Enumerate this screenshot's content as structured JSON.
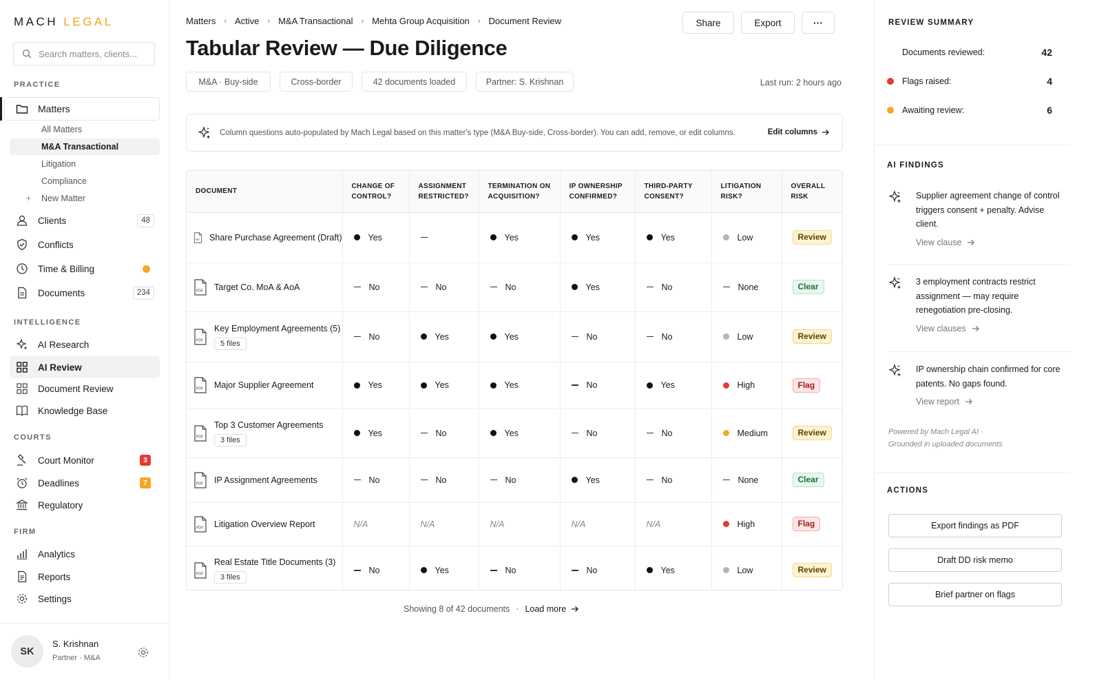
{
  "brand": {
    "part1": "MACH",
    "part2": "LEGAL",
    "accent": "#f2a11a"
  },
  "search": {
    "placeholder": "Search matters, clients..."
  },
  "sidebar": {
    "practice_label": "PRACTICE",
    "matters_label": "Matters",
    "matters_sub": [
      "All Matters",
      "M&A Transactional",
      "Litigation",
      "Compliance",
      "New Matter"
    ],
    "clients": {
      "label": "Clients",
      "count": "48"
    },
    "conflicts": {
      "label": "Conflicts"
    },
    "billing": {
      "label": "Time & Billing"
    },
    "documents": {
      "label": "Documents",
      "count": "234"
    },
    "intelligence_label": "INTELLIGENCE",
    "ai_research": "AI Research",
    "ai_review": "AI Review",
    "document_review": "Document Review",
    "knowledge_base": "Knowledge Base",
    "courts_label": "COURTS",
    "court_monitor": {
      "label": "Court Monitor",
      "count": "3"
    },
    "deadlines": {
      "label": "Deadlines",
      "count": "7"
    },
    "regulatory": "Regulatory",
    "firm_label": "FIRM",
    "analytics": "Analytics",
    "reports": "Reports",
    "settings": "Settings"
  },
  "user": {
    "initials": "SK",
    "name": "S. Krishnan",
    "role": "Partner · M&A"
  },
  "breadcrumb": [
    "Matters",
    "Active",
    "M&A Transactional",
    "Mehta Group Acquisition",
    "Document Review"
  ],
  "header": {
    "share": "Share",
    "export": "Export",
    "more": "···"
  },
  "title": "Tabular Review — Due Diligence",
  "tags": [
    "M&A · Buy-side",
    "Cross-border",
    "42 documents loaded",
    "Partner: S. Krishnan"
  ],
  "last_run": "Last run: 2 hours ago",
  "info": {
    "text": "Column questions auto-populated by Mach Legal based on this matter's type (M&A Buy-side, Cross-border). You can add, remove, or edit columns.",
    "edit": "Edit columns"
  },
  "table": {
    "headers": [
      [
        "DOCUMENT"
      ],
      [
        "CHANGE OF",
        "CONTROL?"
      ],
      [
        "ASSIGNMENT",
        "RESTRICTED?"
      ],
      [
        "TERMINATION ON",
        "ACQUISITION?"
      ],
      [
        "IP OWNERSHIP",
        "CONFIRMED?"
      ],
      [
        "THIRD-PARTY",
        "CONSENT?"
      ],
      [
        "LITIGATION",
        "RISK?"
      ],
      [
        "OVERALL",
        "RISK"
      ]
    ],
    "rows": [
      {
        "doc": "Share Purchase Agreement (Draft)",
        "files": "",
        "cells": [
          "Yes",
          "—",
          "Yes",
          "Yes",
          "Yes"
        ],
        "lit": "Low",
        "overall": "Review"
      },
      {
        "doc": "Target Co. MoA & AoA",
        "files": "",
        "cells": [
          "No",
          "No",
          "No",
          "Yes",
          "No"
        ],
        "lit": "None",
        "overall": "Clear"
      },
      {
        "doc": "Key Employment Agreements (5)",
        "files": "5 files",
        "cells": [
          "No",
          "Yes",
          "Yes",
          "No",
          "No"
        ],
        "lit": "Low",
        "overall": "Review"
      },
      {
        "doc": "Major Supplier Agreement",
        "files": "",
        "cells": [
          "Yes",
          "Yes",
          "Yes",
          "No",
          "Yes"
        ],
        "lit": "High",
        "overall": "Flag"
      },
      {
        "doc": "Top 3 Customer Agreements",
        "files": "3 files",
        "cells": [
          "Yes",
          "No",
          "Yes",
          "No",
          "No"
        ],
        "lit": "Medium",
        "overall": "Review"
      },
      {
        "doc": "IP Assignment Agreements",
        "files": "",
        "cells": [
          "No",
          "No",
          "No",
          "Yes",
          "No"
        ],
        "lit": "None",
        "overall": "Clear"
      },
      {
        "doc": "Litigation Overview Report",
        "files": "",
        "cells": [
          "N/A",
          "N/A",
          "N/A",
          "N/A",
          "N/A"
        ],
        "lit": "High",
        "overall": "Flag"
      },
      {
        "doc": "Real Estate Title Documents (3)",
        "files": "3 files",
        "cells": [
          "No",
          "Yes",
          "No",
          "No",
          "Yes"
        ],
        "lit": "Low",
        "overall": "Review"
      }
    ]
  },
  "pager": {
    "text": "Showing 8 of 42 documents",
    "load": "Load more"
  },
  "review_summary": {
    "title": "REVIEW SUMMARY",
    "reviewed_label": "Documents reviewed:",
    "reviewed": "42",
    "flags_label": "Flags raised:",
    "flags": "4",
    "awaiting_label": "Awaiting review:",
    "awaiting": "6"
  },
  "ai_findings": {
    "title": "AI FINDINGS",
    "items": [
      {
        "text": "Supplier agreement change of control triggers consent + penalty. Advise client.",
        "link": "View clause"
      },
      {
        "text": "3 employment contracts restrict assignment — may require renegotiation pre-closing.",
        "link": "View clauses"
      },
      {
        "text": "IP ownership chain confirmed for core patents. No gaps found.",
        "link": "View report"
      }
    ],
    "powered1": "Powered by Mach Legal AI ·",
    "powered2": "Grounded in uploaded documents"
  },
  "actions": {
    "title": "ACTIONS",
    "buttons": [
      "Export findings as PDF",
      "Draft DD risk memo",
      "Brief partner on flags"
    ]
  },
  "colors": {
    "high": "#e53935",
    "medium": "#f5a623",
    "low": "#b5b5b5",
    "badge_red": "#e53935",
    "badge_orange": "#f5a623"
  }
}
